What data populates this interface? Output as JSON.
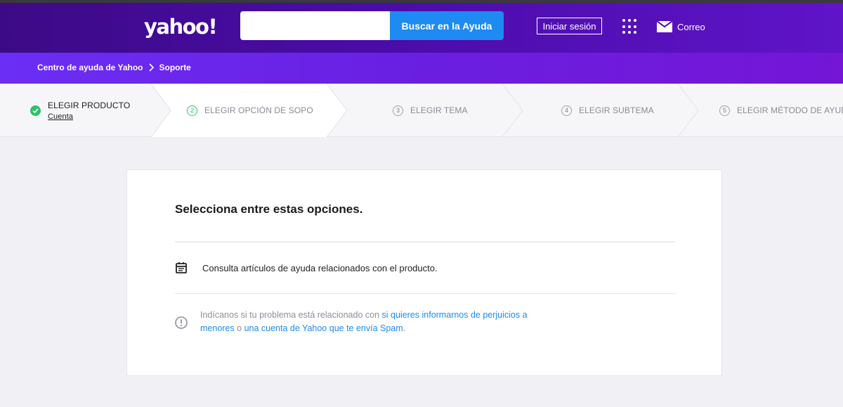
{
  "header": {
    "logo": "yahoo!",
    "search": {
      "value": "",
      "placeholder": "",
      "button_label": "Buscar en la Ayuda"
    },
    "signin_label": "Iniciar sesión",
    "mail_label": "Correo"
  },
  "breadcrumb": {
    "items": [
      "Centro de ayuda de Yahoo",
      "Soporte"
    ]
  },
  "steps": [
    {
      "number": "",
      "label": "ELEGIR PRODUCTO",
      "sub": "Cuenta",
      "state": "done"
    },
    {
      "number": "2",
      "label": "ELEGIR OPCIÓN DE SOPORTE",
      "state": "active"
    },
    {
      "number": "3",
      "label": "ELEGIR TEMA",
      "state": "pending"
    },
    {
      "number": "4",
      "label": "ELEGIR SUBTEMA",
      "state": "pending"
    },
    {
      "number": "5",
      "label": "ELEGIR MÉTODO DE AYUDA",
      "state": "pending"
    }
  ],
  "main": {
    "title": "Selecciona entre estas opciones.",
    "option": {
      "icon": "calendar-icon",
      "text": "Consulta artículos de ayuda relacionados con el producto."
    },
    "info": {
      "icon": "info-icon",
      "prefix": "Indícanos si tu problema está relacionado con",
      "link1": "si quieres informarnos de perjuicios a menores",
      "middle": "o",
      "link2": "una cuenta de Yahoo que te envía Spam",
      "suffix": "."
    }
  },
  "colors": {
    "header": "#4a0ca8",
    "accent": "#1d8bf1",
    "success": "#2ec16a"
  }
}
